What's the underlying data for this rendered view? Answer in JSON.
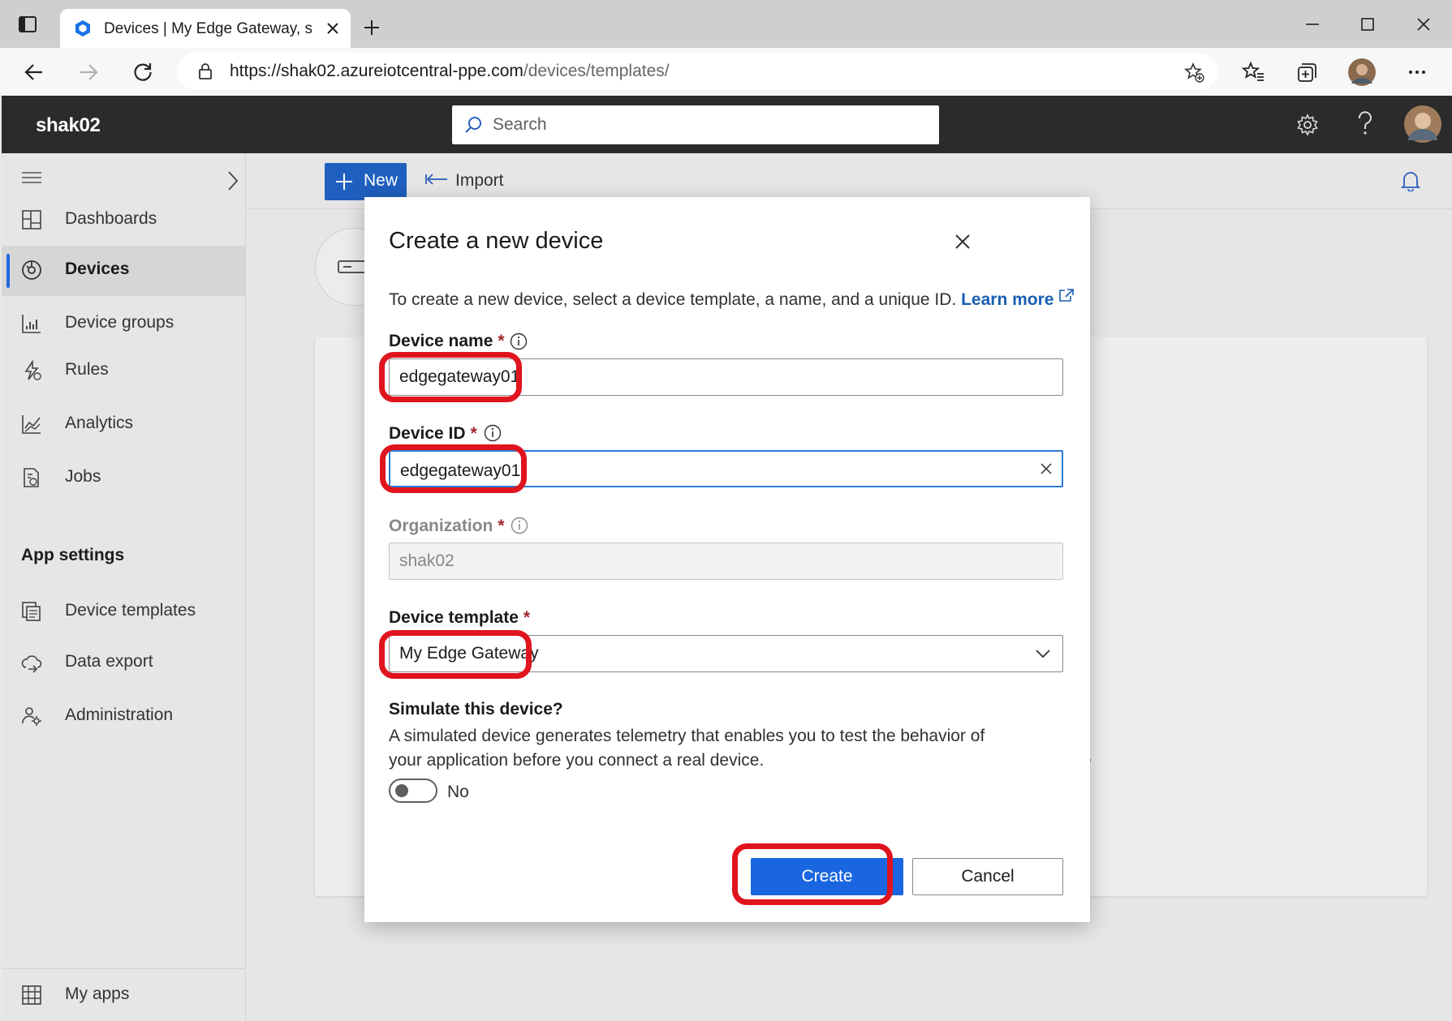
{
  "browser": {
    "tab_title": "Devices | My Edge Gateway, shak",
    "url_main": "https://shak02.azureiotcentral-ppe.com",
    "url_path": "/devices/templates/",
    "icons": [
      "tab-actions-icon",
      "new-tab-icon",
      "minimize-icon",
      "maximize-icon",
      "close-window-icon",
      "back-icon",
      "forward-icon",
      "refresh-icon",
      "lock-icon",
      "add-favorite-icon",
      "favorites-icon",
      "collections-icon",
      "profile-avatar",
      "more-icon"
    ]
  },
  "header": {
    "app_name": "shak02",
    "search_placeholder": "Search",
    "icons": [
      "settings-icon",
      "help-icon",
      "user-avatar"
    ]
  },
  "sidebar": {
    "items": [
      {
        "label": "Dashboards",
        "icon": "dashboard-icon"
      },
      {
        "label": "Devices",
        "icon": "devices-icon",
        "selected": true
      },
      {
        "label": "Device groups",
        "icon": "device-groups-icon"
      },
      {
        "label": "Rules",
        "icon": "rules-icon"
      },
      {
        "label": "Analytics",
        "icon": "analytics-icon"
      },
      {
        "label": "Jobs",
        "icon": "jobs-icon"
      }
    ],
    "section_title": "App settings",
    "settings_items": [
      {
        "label": "Device templates",
        "icon": "device-templates-icon"
      },
      {
        "label": "Data export",
        "icon": "data-export-icon"
      },
      {
        "label": "Administration",
        "icon": "administration-icon"
      }
    ],
    "footer_item": {
      "label": "My apps",
      "icon": "my-apps-icon"
    }
  },
  "commandbar": {
    "new_label": "New",
    "import_label": "Import"
  },
  "background": {
    "partial_text": "e,"
  },
  "modal": {
    "title": "Create a new device",
    "description": "To create a new device, select a device template, a name, and a unique ID.",
    "learn_more": "Learn more",
    "required_mark": "*",
    "device_name": {
      "label": "Device name",
      "value": "edgegateway01"
    },
    "device_id": {
      "label": "Device ID",
      "value": "edgegateway01"
    },
    "organization": {
      "label": "Organization",
      "value": "shak02"
    },
    "device_template": {
      "label": "Device template",
      "value": "My Edge Gateway"
    },
    "simulate": {
      "title": "Simulate this device?",
      "description": "A simulated device generates telemetry that enables you to test the behavior of your application before you connect a real device.",
      "toggle_label": "No",
      "toggle_on": false
    },
    "create_label": "Create",
    "cancel_label": "Cancel"
  },
  "colors": {
    "accent": "#1a66e0",
    "highlight": "#e0141e",
    "header_bg": "#2b2b2b",
    "required": "#a4262c"
  }
}
